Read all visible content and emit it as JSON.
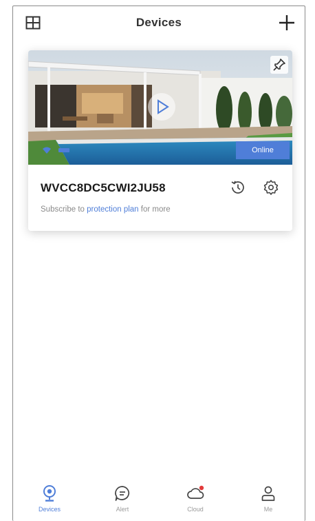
{
  "header": {
    "title": "Devices"
  },
  "device_card": {
    "name": "WVCC8DC5CWI2JU58",
    "status": "Online",
    "subscribe_prefix": "Subscribe to ",
    "subscribe_link": "protection plan",
    "subscribe_suffix": " for more"
  },
  "nav": {
    "items": [
      {
        "label": "Devices",
        "icon": "camera-icon",
        "active": true
      },
      {
        "label": "Alert",
        "icon": "message-icon",
        "active": false
      },
      {
        "label": "Cloud",
        "icon": "cloud-icon",
        "active": false
      },
      {
        "label": "Me",
        "icon": "person-icon",
        "active": false
      }
    ]
  },
  "colors": {
    "accent": "#4f7ed8",
    "notification": "#e23b3b"
  }
}
